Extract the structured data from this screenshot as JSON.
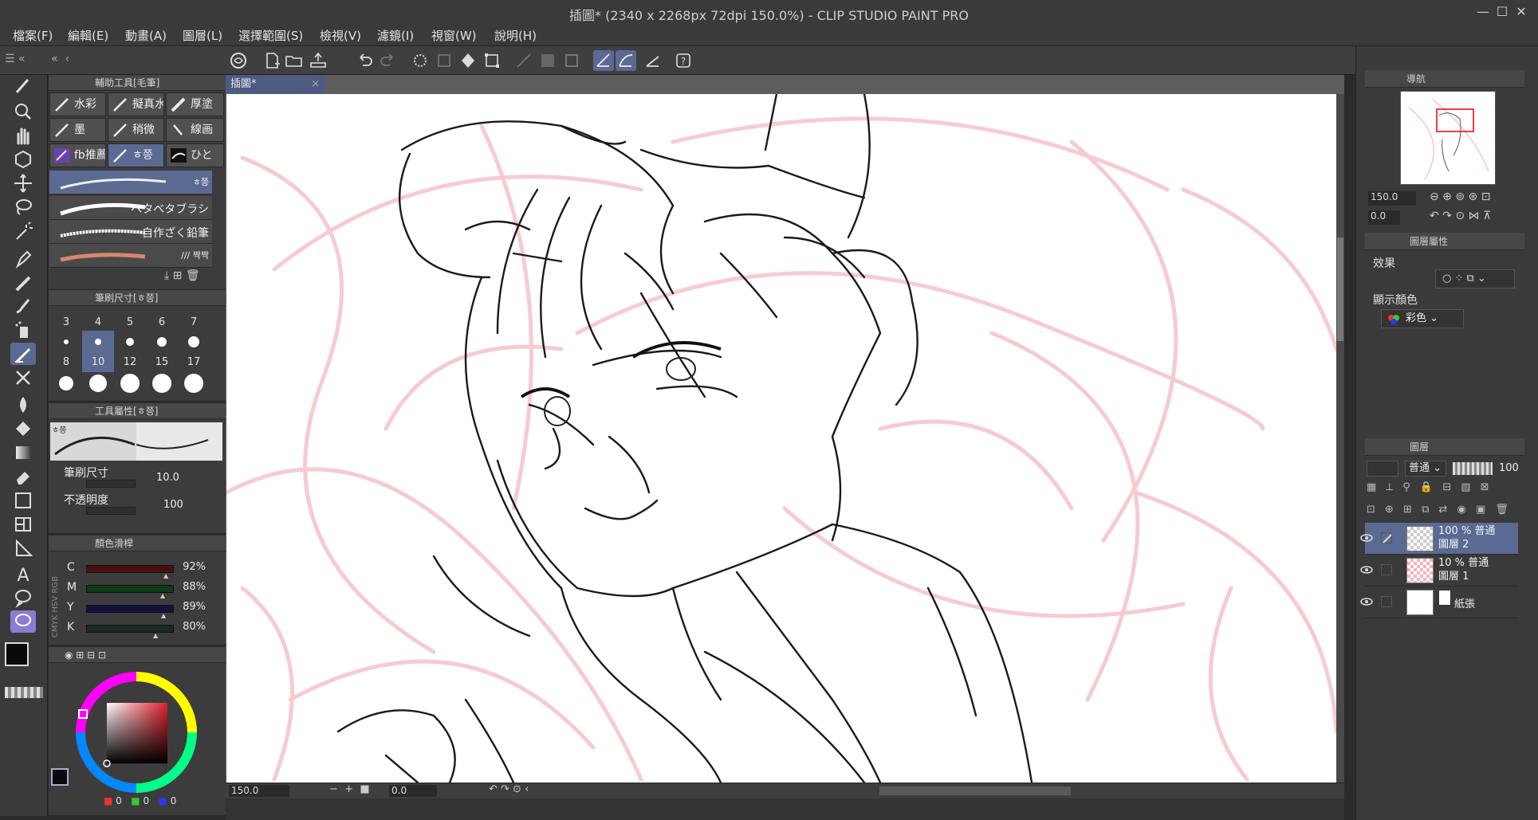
{
  "window": {
    "title": "插圖* (2340 x 2268px 72dpi 150.0%)  - CLIP STUDIO PAINT PRO",
    "minimize": "—",
    "maximize": "☐",
    "close": "✕"
  },
  "menu": [
    "檔案(F)",
    "編輯(E)",
    "動畫(A)",
    "圖層(L)",
    "選擇範圍(S)",
    "檢視(V)",
    "濾鏡(I)",
    "視窗(W)",
    "說明(H)"
  ],
  "document": {
    "tab_label": "插圖*",
    "tab_close": "×"
  },
  "sub_tool": {
    "header": "輔助工具[毛筆]",
    "chips": [
      "水彩",
      "擬真水",
      "厚塗",
      "墨",
      "稍微",
      "線画",
      "fb推薦",
      "ㅎ쯩",
      "ひと"
    ],
    "brushes": [
      "ㅎ쯩",
      "ベタベタブラシ",
      "自作ざく鉛筆",
      "/// 짝짝"
    ]
  },
  "brush_size": {
    "header": "筆刷尺寸[ㅎ쯩]",
    "sizes_row1": [
      "3",
      "4",
      "5",
      "6",
      "7"
    ],
    "sizes_row2": [
      "8",
      "10",
      "12",
      "15",
      "17"
    ],
    "selected": "10"
  },
  "tool_property": {
    "header": "工具屬性[ㅎ쯩]",
    "preview_label": "ㅎ쯩",
    "brush_size_label": "筆刷尺寸",
    "brush_size_value": "10.0",
    "opacity_label": "不透明度",
    "opacity_value": "100"
  },
  "color_slider": {
    "header": "顏色滑桿",
    "mode_tabs": [
      "RGB",
      "HSV",
      "CMYK"
    ],
    "channels": [
      {
        "label": "C",
        "value": "92%",
        "fraction": 0.92,
        "color": "#4a1010"
      },
      {
        "label": "M",
        "value": "88%",
        "fraction": 0.88,
        "color": "#0e3a16"
      },
      {
        "label": "Y",
        "value": "89%",
        "fraction": 0.89,
        "color": "#12123f"
      },
      {
        "label": "K",
        "value": "80%",
        "fraction": 0.8,
        "color": "#1c2a2a"
      }
    ]
  },
  "color_wheel": {
    "rgb_values": [
      "0",
      "0",
      "0"
    ]
  },
  "status": {
    "zoom": "150.0",
    "rotation": "0.0"
  },
  "navigator": {
    "header": "導航",
    "zoom": "150.0",
    "rotation": "0.0"
  },
  "layer_property": {
    "header": "圖層屬性",
    "effect_label": "效果",
    "display_color_label": "顯示顏色",
    "display_color_value": "彩色"
  },
  "layers_panel": {
    "header": "圖層",
    "blend_mode": "普通",
    "opacity": "100",
    "layers": [
      {
        "line1": "100 % 普通",
        "line2": "圖層 2",
        "selected": true
      },
      {
        "line1": "10 % 普通",
        "line2": "圖層 1",
        "selected": false
      },
      {
        "line1": "",
        "line2": "紙張",
        "selected": false
      }
    ]
  },
  "colors": {
    "accent": "#5a6a92",
    "sketch_pink": "#f6c6cc",
    "ink": "#1a1a1a"
  }
}
